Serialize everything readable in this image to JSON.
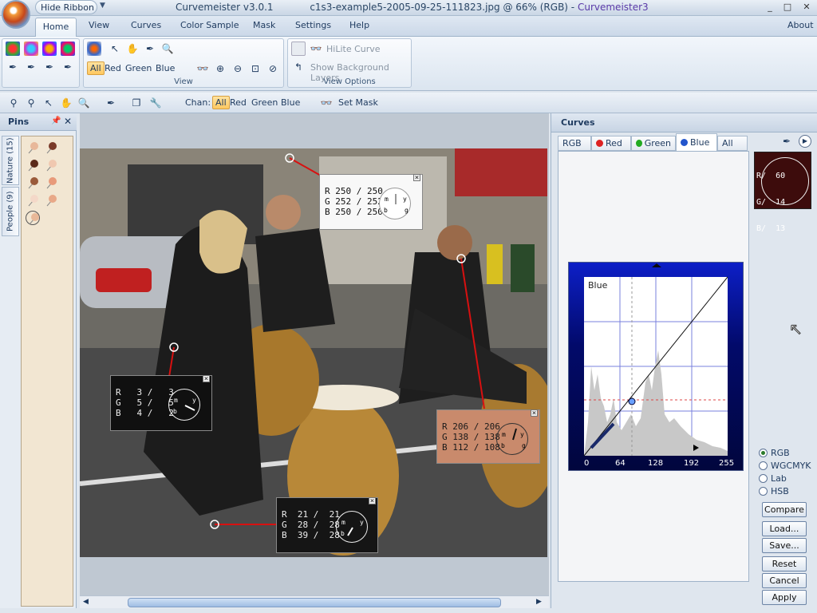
{
  "titlebar": {
    "hide_ribbon": "Hide Ribbon",
    "version": "Curvemeister v3.0.1",
    "file": "c1s3-example5-2005-09-25-111823.jpg @ 66% (RGB) -",
    "app": "Curvemeister3",
    "min": "_",
    "max": "□",
    "close": "✕"
  },
  "menu": {
    "home": "Home",
    "view": "View",
    "curves": "Curves",
    "color_sample": "Color Sample",
    "mask": "Mask",
    "settings": "Settings",
    "help": "Help",
    "about": "About"
  },
  "ribbon": {
    "view_group": "View",
    "view_options_group": "View Options",
    "chan": {
      "all": "All",
      "red": "Red",
      "green": "Green",
      "blue": "Blue"
    },
    "hilite": "HiLite Curve",
    "show_bg": "Show Background Layers"
  },
  "toolbar2": {
    "chan_label": "Chan:",
    "all": "All",
    "red": "Red",
    "green": "Green",
    "blue": "Blue",
    "set_mask": "Set Mask"
  },
  "pins": {
    "title": "Pins",
    "tabs": [
      "Nature (15)",
      "People (9)"
    ]
  },
  "probes": [
    {
      "r": "R 250 / 250",
      "g": "G 252 / 252",
      "b": "B 250 / 250"
    },
    {
      "r": "R   3 /   3",
      "g": "G   5 /   5",
      "b": "B   4 /   2"
    },
    {
      "r": "R 206 / 206",
      "g": "G 138 / 138",
      "b": "B 112 / 108"
    },
    {
      "r": "R  21 /  21",
      "g": "G  28 /  28",
      "b": "B  39 /  28"
    }
  ],
  "curves": {
    "title": "Curves",
    "tabs": {
      "rgb": "RGB",
      "red": "Red",
      "green": "Green",
      "blue": "Blue",
      "all": "All"
    },
    "graph_label": "Blue",
    "ticks": [
      "0",
      "64",
      "128",
      "192",
      "255"
    ],
    "sample": {
      "r": "R/  60",
      "g": "G/  14",
      "b": "B/  13"
    },
    "modes": [
      "RGB",
      "WGCMYK",
      "Lab",
      "HSB"
    ],
    "buttons": {
      "compare": "Compare",
      "load": "Load...",
      "save": "Save...",
      "reset": "Reset",
      "cancel": "Cancel",
      "apply": "Apply"
    },
    "colors": {
      "swatch": "#3d0c0c",
      "graph_bg": "#0d1fc7"
    }
  }
}
